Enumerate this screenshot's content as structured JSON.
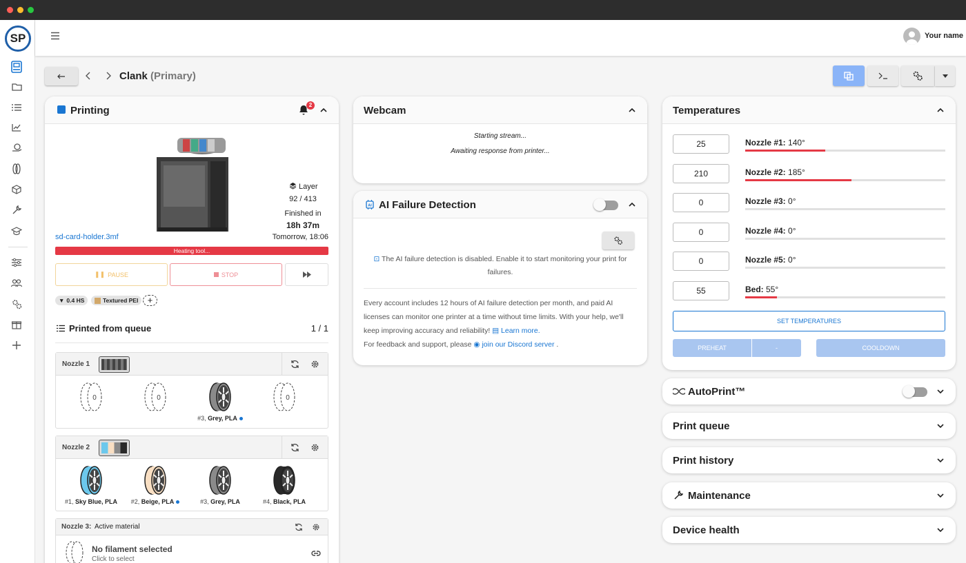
{
  "header": {
    "username": "Your name"
  },
  "breadcrumb": {
    "printer_name": "Clank",
    "printer_role": "(Primary)"
  },
  "printing": {
    "title": "Printing",
    "notif_count": "2",
    "filename": "sd-card-holder.3mf",
    "layer_label": "Layer",
    "layer_value": "92 / 413",
    "finished_label": "Finished in",
    "finished_value": "18h 37m",
    "finished_time": "Tomorrow, 18:06",
    "progress_text": "Heating tool...",
    "progress_fraction": 1.0,
    "pause_label": "PAUSE",
    "stop_label": "STOP",
    "chips": [
      "0.4 HS",
      "Textured PEI"
    ],
    "queue_title": "Printed from queue",
    "queue_count": "1 / 1",
    "nozzles": [
      {
        "name": "Nozzle 1",
        "spools": [
          {
            "label": "",
            "color": "empty"
          },
          {
            "label": "",
            "color": "empty"
          },
          {
            "num": "#3,",
            "label": "Grey, PLA",
            "color": "#8a8a8a",
            "dot": true
          },
          {
            "label": "",
            "color": "empty"
          }
        ]
      },
      {
        "name": "Nozzle 2",
        "spools": [
          {
            "num": "#1,",
            "label": "Sky Blue, PLA",
            "color": "#6cc8ec"
          },
          {
            "num": "#2,",
            "label": "Beige, PLA",
            "color": "#f9dfc3",
            "dot": true
          },
          {
            "num": "#3,",
            "label": "Grey, PLA",
            "color": "#8a8a8a"
          },
          {
            "num": "#4,",
            "label": "Black, PLA",
            "color": "#2a2a2a"
          }
        ]
      }
    ],
    "nozzle3": {
      "name": "Nozzle 3:",
      "mode": "Active material",
      "no_fil": "No filament selected",
      "click": "Click to select"
    },
    "spool_empty_count": "0"
  },
  "webcam": {
    "title": "Webcam",
    "line1": "Starting stream...",
    "line2": "Awaiting response from printer..."
  },
  "ai": {
    "title": "AI Failure Detection",
    "disabled_text": "The AI failure detection is disabled. Enable it to start monitoring your print for failures.",
    "info": "Every account includes 12 hours of AI failure detection per month, and paid AI licenses can monitor one printer at a time without time limits. With your help, we'll keep improving accuracy and reliability!",
    "learn_more": "Learn more.",
    "feedback": "For feedback and support, please",
    "discord": "join our Discord server",
    "feedback_end": "."
  },
  "temperatures": {
    "title": "Temperatures",
    "rows": [
      {
        "input": "25",
        "label": "Nozzle #1:",
        "value": "140°",
        "fraction": 0.4
      },
      {
        "input": "210",
        "label": "Nozzle #2:",
        "value": "185°",
        "fraction": 0.53
      },
      {
        "input": "0",
        "label": "Nozzle #3:",
        "value": "0°",
        "fraction": 0
      },
      {
        "input": "0",
        "label": "Nozzle #4:",
        "value": "0°",
        "fraction": 0
      },
      {
        "input": "0",
        "label": "Nozzle #5:",
        "value": "0°",
        "fraction": 0
      },
      {
        "input": "55",
        "label": "Bed:",
        "value": "55°",
        "fraction": 0.16
      }
    ],
    "set_label": "SET TEMPERATURES",
    "preheat_label": "PREHEAT",
    "preheat_opt": "-",
    "cooldown_label": "COOLDOWN"
  },
  "accordions": {
    "autoprint": "AutoPrint™",
    "queue": "Print queue",
    "history": "Print history",
    "maintenance": "Maintenance",
    "health": "Device health"
  },
  "colors": {
    "accent": "#1976d2",
    "danger": "#e53945",
    "progress": "#e53945"
  }
}
